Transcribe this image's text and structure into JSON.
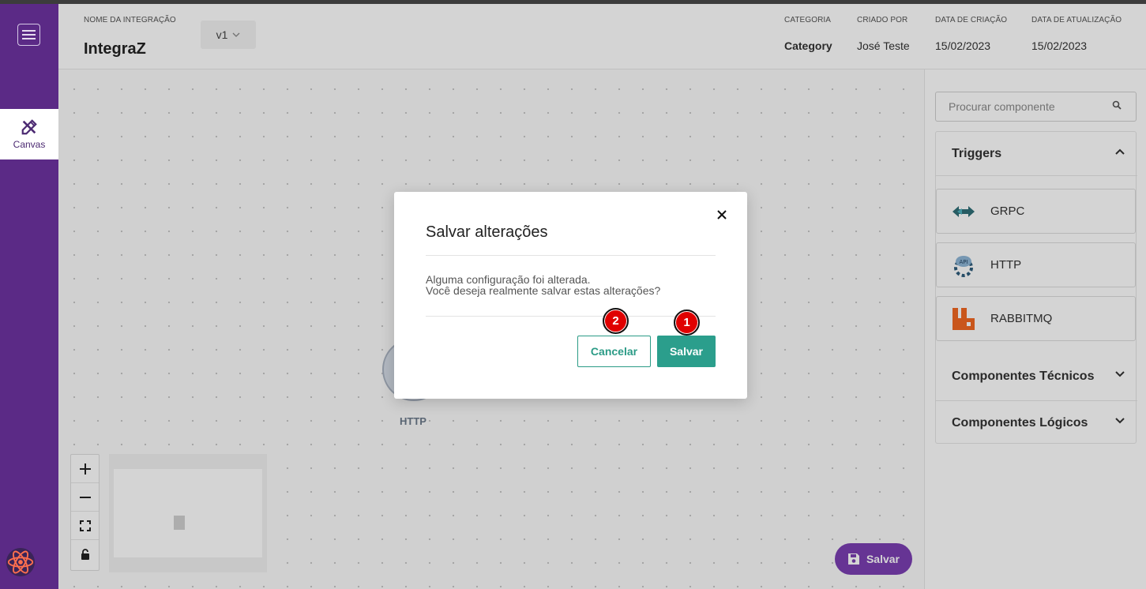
{
  "header": {
    "integration_name_label": "NOME DA INTEGRAÇÃO",
    "integration_name": "IntegraZ",
    "version": "v1",
    "category_label": "CATEGORIA",
    "category": "Category",
    "created_by_label": "CRIADO POR",
    "created_by": "José Teste",
    "created_date_label": "DATA DE CRIAÇÃO",
    "created_date": "15/02/2023",
    "updated_date_label": "DATA DE ATUALIZAÇÃO",
    "updated_date": "15/02/2023"
  },
  "sidebar": {
    "items": [
      {
        "label": "Canvas",
        "icon": "pencil-ruler-icon"
      }
    ]
  },
  "canvas": {
    "node_label": "HTTP",
    "save_button": "Salvar"
  },
  "right_panel": {
    "search_placeholder": "Procurar componente",
    "sections": [
      {
        "title": "Triggers",
        "expanded": true
      },
      {
        "title": "Componentes Técnicos",
        "expanded": false
      },
      {
        "title": "Componentes Lógicos",
        "expanded": false
      }
    ],
    "triggers": [
      {
        "name": "GRPC",
        "icon": "grpc-icon"
      },
      {
        "name": "HTTP",
        "icon": "http-api-icon"
      },
      {
        "name": "RABBITMQ",
        "icon": "rabbitmq-icon"
      }
    ]
  },
  "modal": {
    "title": "Salvar alterações",
    "body_line1": "Alguma configuração foi alterada.",
    "body_line2": "Você deseja realmente salvar estas alterações?",
    "cancel_label": "Cancelar",
    "save_label": "Salvar",
    "badges": [
      "1",
      "2"
    ]
  },
  "colors": {
    "sidebar": "#5b2a86",
    "accent_teal": "#2b9e8c",
    "fab_purple": "#7b3fb3",
    "badge_red": "#e00000"
  }
}
